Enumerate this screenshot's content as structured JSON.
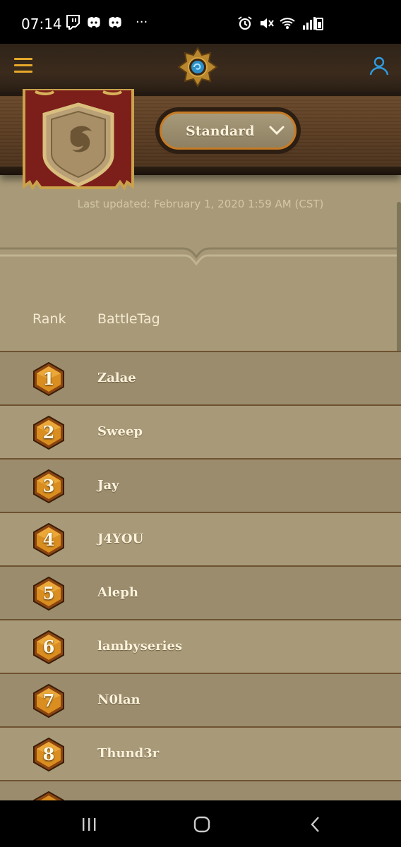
{
  "status_bar": {
    "time": "07:14",
    "left_icons": [
      "twitch-icon",
      "discord-icon",
      "discord-icon",
      "more-dots-icon"
    ],
    "right_icons": [
      "alarm-icon",
      "mute-icon",
      "wifi-icon",
      "signal-icon",
      "battery-icon"
    ],
    "more": "···"
  },
  "header": {
    "menu_icon": "hamburger-menu-icon",
    "logo": "hearthstone-logo-icon",
    "account_icon": "user-icon",
    "accent_color": "#e6a82a",
    "account_color": "#2f9ce0"
  },
  "mode_selector": {
    "selected": "Standard"
  },
  "last_updated": "Last updated: February 1, 2020 1:59 AM (CST)",
  "table": {
    "columns": [
      "Rank",
      "BattleTag"
    ],
    "rows": [
      {
        "rank": "1",
        "battletag": "Zalae"
      },
      {
        "rank": "2",
        "battletag": "Sweep"
      },
      {
        "rank": "3",
        "battletag": "Jay"
      },
      {
        "rank": "4",
        "battletag": "J4YOU"
      },
      {
        "rank": "5",
        "battletag": "Aleph"
      },
      {
        "rank": "6",
        "battletag": "lambyseries"
      },
      {
        "rank": "7",
        "battletag": "N0lan"
      },
      {
        "rank": "8",
        "battletag": "Thund3r"
      }
    ]
  },
  "nav_bar": {
    "buttons": [
      "recent-apps-icon",
      "home-icon",
      "back-icon"
    ]
  }
}
